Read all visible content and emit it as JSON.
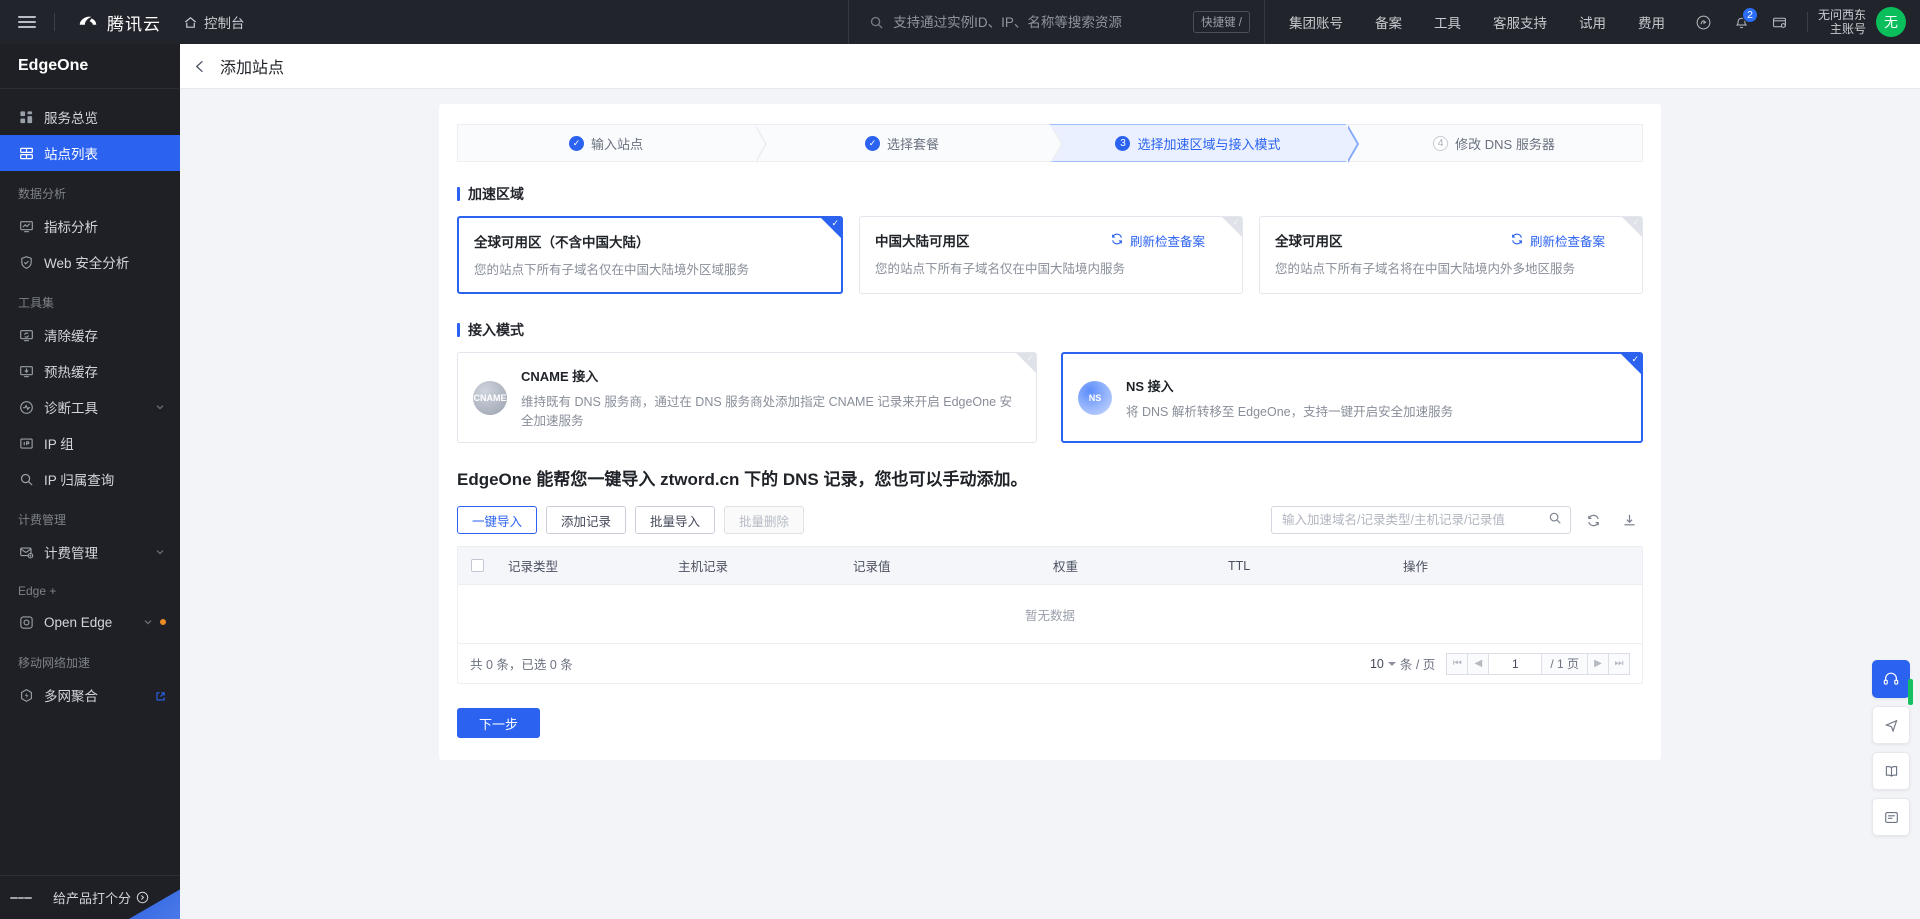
{
  "topbar": {
    "menu_icon": "hamburger-icon",
    "brand": "腾讯云",
    "console": "控制台",
    "home_icon": "home-icon",
    "search_placeholder": "支持通过实例ID、IP、名称等搜索资源",
    "search_value": "",
    "search_icon": "search-icon",
    "hotkey_label": "快捷键 /",
    "nav": [
      {
        "label": "集团账号"
      },
      {
        "label": "备案"
      },
      {
        "label": "工具"
      },
      {
        "label": "客服支持"
      },
      {
        "label": "试用"
      },
      {
        "label": "费用"
      }
    ],
    "icons": [
      {
        "name": "support-circle-icon"
      },
      {
        "name": "bell-icon",
        "badge": "2"
      },
      {
        "name": "card-settings-icon"
      }
    ],
    "user_name": "无问西东",
    "user_role": "主账号",
    "avatar_text": "无",
    "avatar_color": "#0abf5b"
  },
  "sidebar": {
    "title": "EdgeOne",
    "items": [
      {
        "label": "服务总览",
        "icon": "dashboard-icon",
        "type": "item",
        "active": false
      },
      {
        "label": "站点列表",
        "icon": "sites-icon",
        "type": "item",
        "active": true
      },
      {
        "label": "数据分析",
        "type": "group"
      },
      {
        "label": "指标分析",
        "icon": "metrics-icon",
        "type": "item",
        "active": false
      },
      {
        "label": "Web 安全分析",
        "icon": "shield-icon",
        "type": "item",
        "active": false
      },
      {
        "label": "工具集",
        "type": "group"
      },
      {
        "label": "清除缓存",
        "icon": "purge-cache-icon",
        "type": "item",
        "active": false
      },
      {
        "label": "预热缓存",
        "icon": "prefetch-cache-icon",
        "type": "item",
        "active": false
      },
      {
        "label": "诊断工具",
        "icon": "diagnose-icon",
        "type": "item",
        "active": false,
        "chevron": true
      },
      {
        "label": "IP 组",
        "icon": "ip-group-icon",
        "type": "item",
        "active": false
      },
      {
        "label": "IP 归属查询",
        "icon": "search-icon",
        "type": "item",
        "active": false
      },
      {
        "label": "计费管理",
        "type": "group"
      },
      {
        "label": "计费管理",
        "icon": "billing-icon",
        "type": "item",
        "active": false,
        "chevron": true
      },
      {
        "label": "Edge +",
        "type": "group"
      },
      {
        "label": "Open Edge",
        "icon": "open-edge-icon",
        "type": "item",
        "active": false,
        "chevron": true,
        "dot": true
      },
      {
        "label": "移动网络加速",
        "type": "group"
      },
      {
        "label": "多网聚合",
        "icon": "multi-network-icon",
        "type": "item",
        "active": false,
        "external": true
      }
    ],
    "collapse_icon": "collapse-sidebar-icon",
    "rate_label": "给产品打个分",
    "rate_icon": "arrow-right-circle-icon"
  },
  "page": {
    "back_icon": "back-arrow-icon",
    "title": "添加站点"
  },
  "steps": [
    {
      "label": "输入站点",
      "state": "done",
      "marker": "✓"
    },
    {
      "label": "选择套餐",
      "state": "done",
      "marker": "✓"
    },
    {
      "label": "选择加速区域与接入模式",
      "state": "current",
      "marker": "3"
    },
    {
      "label": "修改 DNS 服务器",
      "state": "pending",
      "marker": "4"
    }
  ],
  "region_section": {
    "title": "加速区域",
    "cards": [
      {
        "title": "全球可用区（不含中国大陆）",
        "desc": "您的站点下所有子域名仅在中国大陆境外区域服务",
        "selected": true,
        "refresh_label": ""
      },
      {
        "title": "中国大陆可用区",
        "desc": "您的站点下所有子域名仅在中国大陆境内服务",
        "selected": false,
        "refresh_label": "刷新检查备案"
      },
      {
        "title": "全球可用区",
        "desc": "您的站点下所有子域名将在中国大陆境内外多地区服务",
        "selected": false,
        "refresh_label": "刷新检查备案"
      }
    ]
  },
  "mode_section": {
    "title": "接入模式",
    "cards": [
      {
        "badge": "CNAME",
        "title": "CNAME 接入",
        "desc": "维持既有 DNS 服务商，通过在 DNS 服务商处添加指定 CNAME 记录来开启 EdgeOne 安全加速服务",
        "selected": false
      },
      {
        "badge": "NS",
        "title": "NS 接入",
        "desc": "将 DNS 解析转移至 EdgeOne，支持一键开启安全加速服务",
        "selected": true
      }
    ]
  },
  "dns": {
    "headline": "EdgeOne 能帮您一键导入 ztword.cn 下的 DNS 记录，您也可以手动添加。",
    "buttons": [
      {
        "label": "一键导入",
        "style": "primary-line",
        "disabled": false
      },
      {
        "label": "添加记录",
        "style": "default",
        "disabled": false
      },
      {
        "label": "批量导入",
        "style": "default",
        "disabled": false
      },
      {
        "label": "批量删除",
        "style": "default",
        "disabled": true
      }
    ],
    "search_placeholder": "输入加速域名/记录类型/主机记录/记录值",
    "search_value": "",
    "search_icon": "search-icon",
    "refresh_icon": "refresh-icon",
    "download_icon": "download-icon",
    "table": {
      "columns": [
        "记录类型",
        "主机记录",
        "记录值",
        "权重",
        "TTL",
        "操作"
      ],
      "rows": [],
      "empty_text": "暂无数据"
    },
    "footer": {
      "total_text": "共 0 条，已选 0 条",
      "page_size": "10",
      "page_size_suffix": "条 / 页",
      "current_page": "1",
      "total_pages": "/ 1 页",
      "first_icon": "first-page-icon",
      "prev_icon": "prev-page-icon",
      "next_icon": "next-page-icon",
      "last_icon": "last-page-icon"
    }
  },
  "footer": {
    "next_label": "下一步"
  },
  "dock": [
    {
      "name": "headset-support-icon",
      "style": "blue"
    },
    {
      "name": "share-icon",
      "style": "plain"
    },
    {
      "name": "docs-icon",
      "style": "plain"
    },
    {
      "name": "feedback-icon",
      "style": "plain"
    }
  ],
  "colors": {
    "accent": "#2b63f0",
    "sidebar_bg": "#1e2025",
    "topbar_bg": "#21242a",
    "page_bg": "#f3f4f7",
    "avatar_green": "#0abf5b",
    "dot_orange": "#ec8b25"
  }
}
